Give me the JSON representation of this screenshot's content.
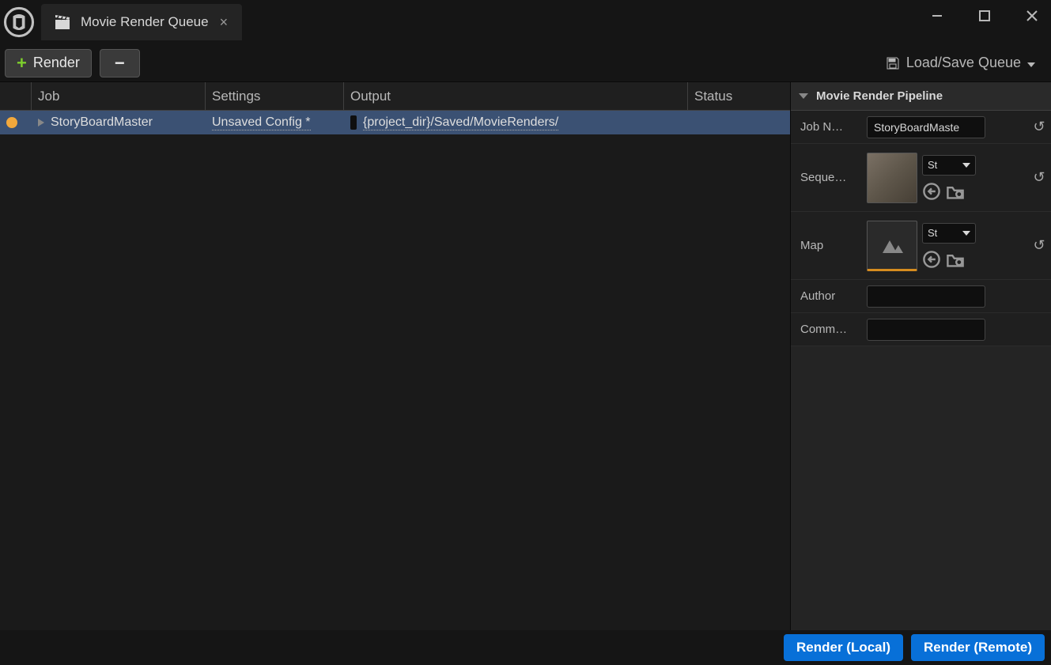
{
  "titlebar": {
    "tab_title": "Movie Render Queue"
  },
  "toolbar": {
    "render_label": "Render",
    "load_save_label": "Load/Save Queue"
  },
  "table": {
    "headers": {
      "job": "Job",
      "settings": "Settings",
      "output": "Output",
      "status": "Status"
    },
    "row": {
      "job": "StoryBoardMaster",
      "settings": "Unsaved Config *",
      "output": "{project_dir}/Saved/MovieRenders/"
    }
  },
  "details": {
    "title": "Movie Render Pipeline",
    "props": {
      "job_name": {
        "label": "Job N…",
        "value": "StoryBoardMaste"
      },
      "sequence": {
        "label": "Seque…",
        "value": "St"
      },
      "map": {
        "label": "Map",
        "value": "St"
      },
      "author": {
        "label": "Author",
        "value": ""
      },
      "comment": {
        "label": "Comm…",
        "value": ""
      }
    }
  },
  "footer": {
    "render_local": "Render (Local)",
    "render_remote": "Render (Remote)"
  }
}
